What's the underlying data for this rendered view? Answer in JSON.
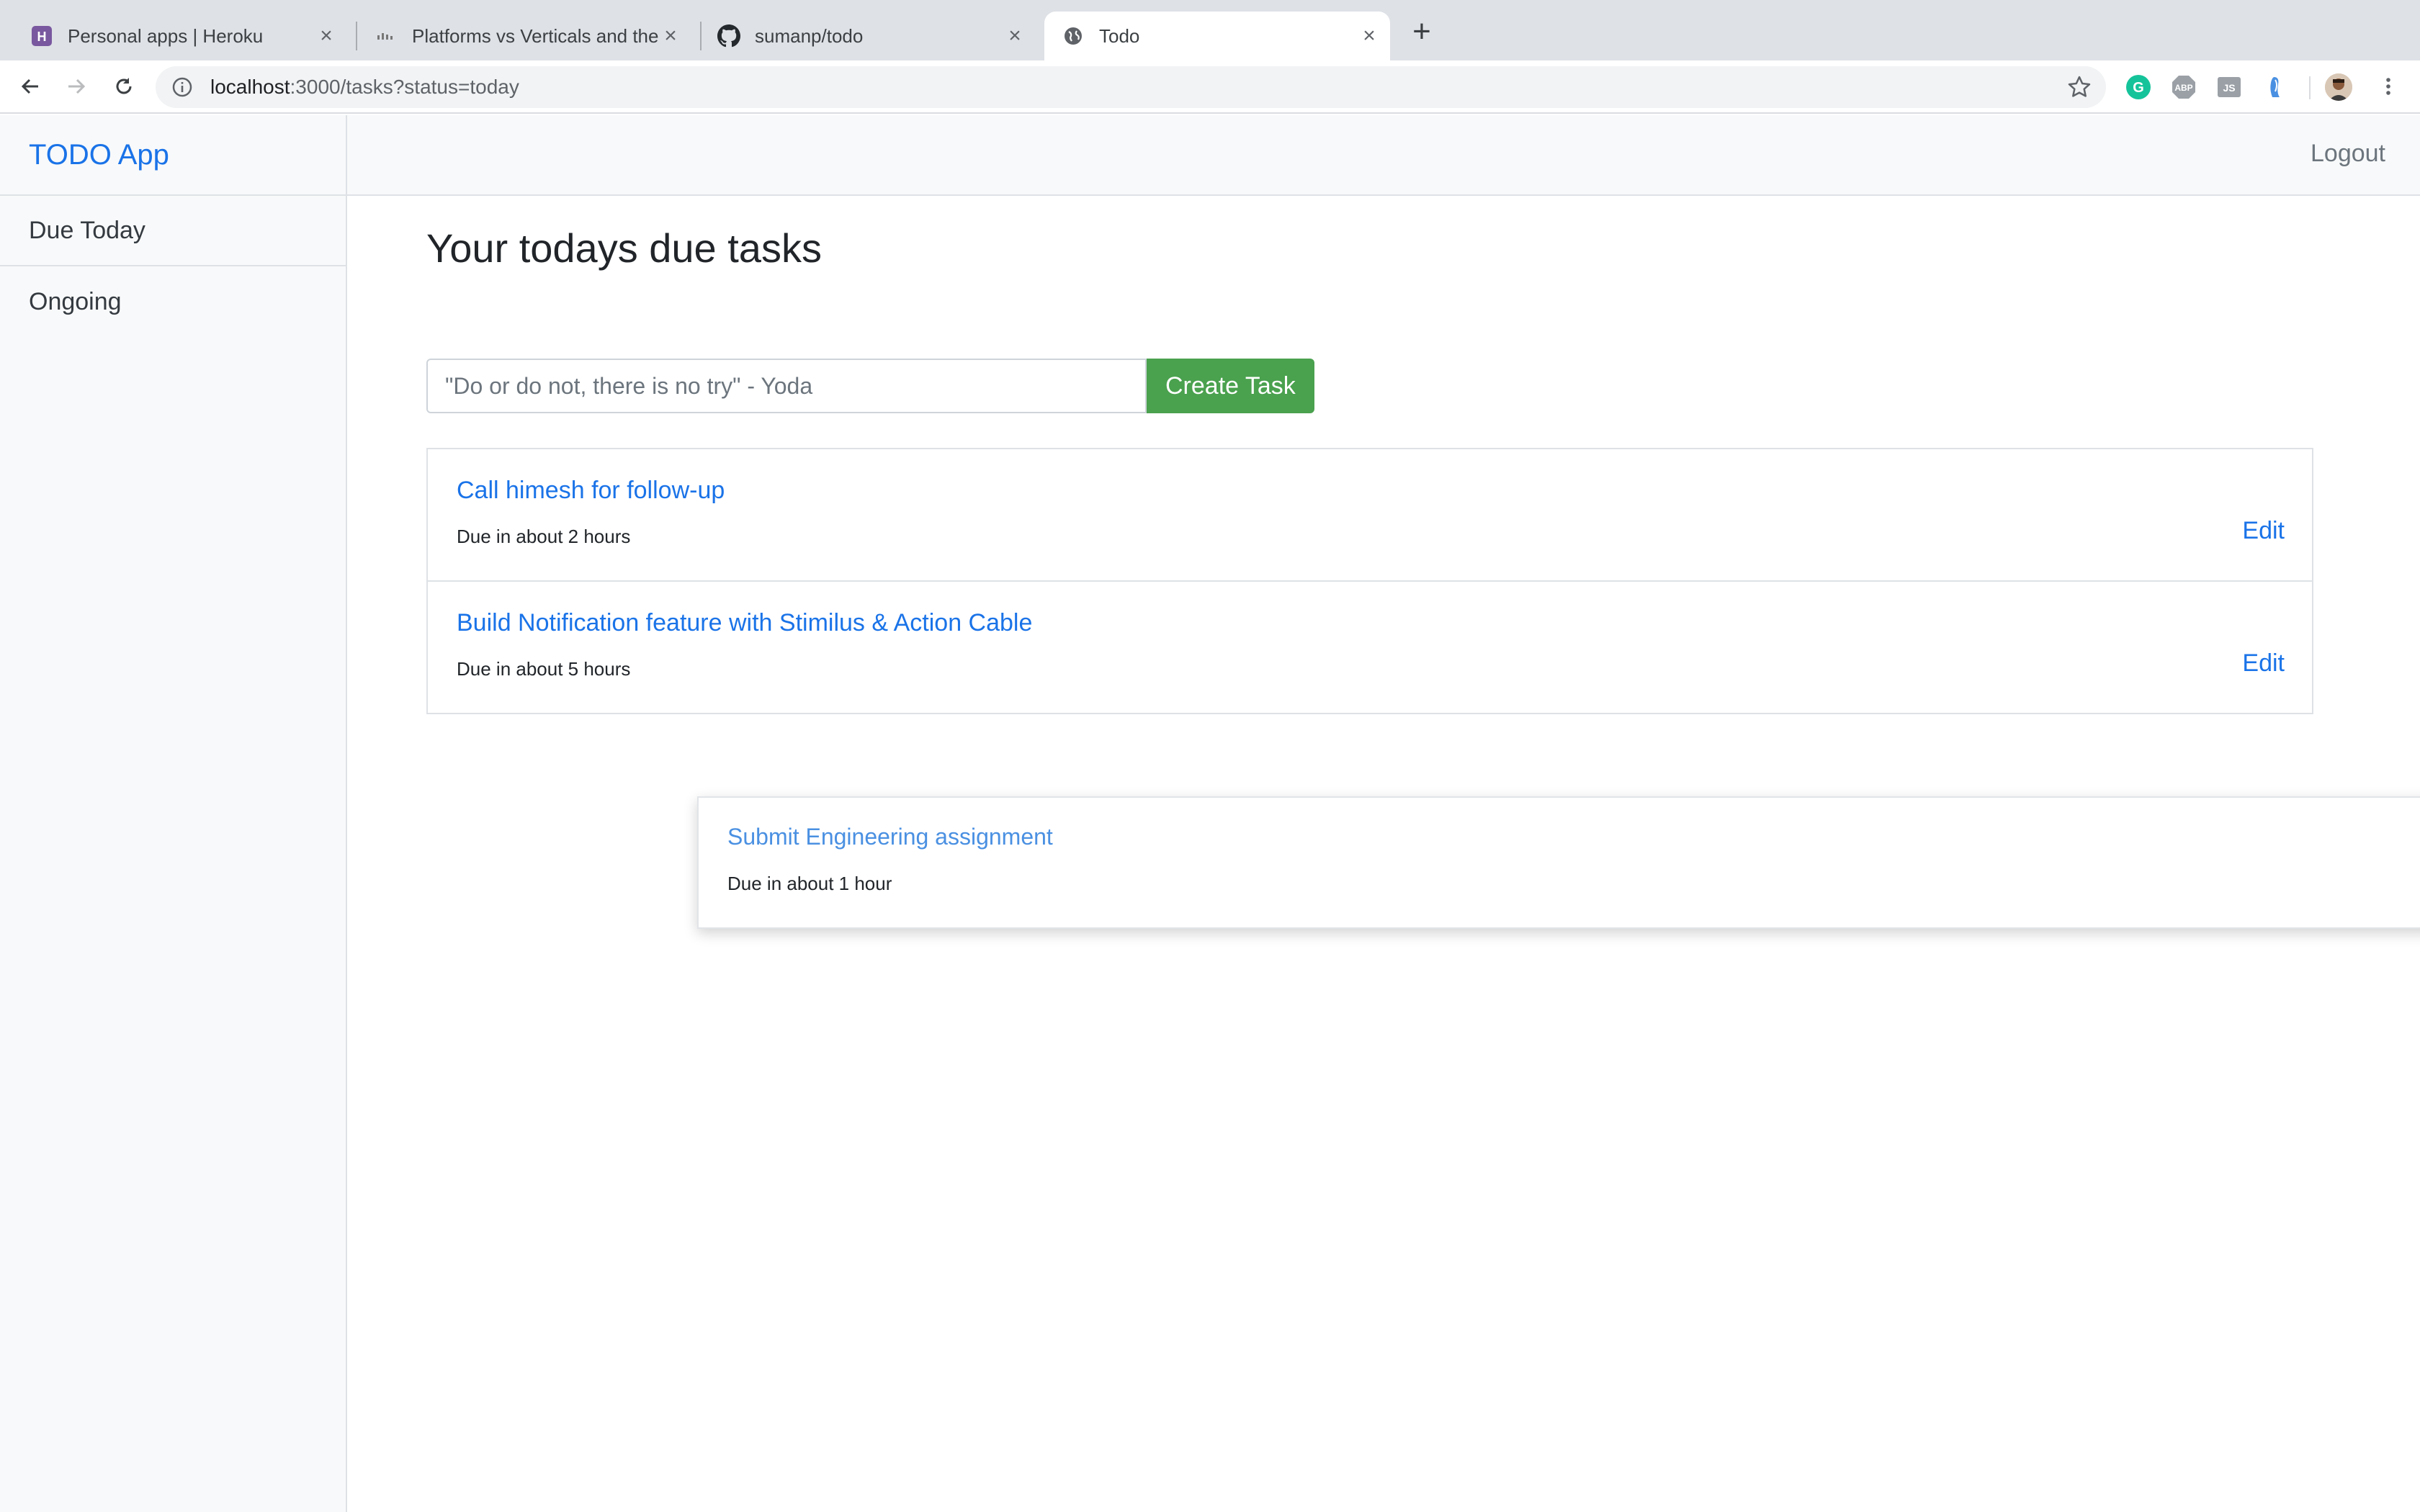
{
  "browser": {
    "tabs": [
      {
        "title": "Personal apps | Heroku",
        "icon": "heroku-icon",
        "active": false
      },
      {
        "title": "Platforms vs Verticals and the",
        "icon": "site-icon",
        "active": false
      },
      {
        "title": "sumanp/todo",
        "icon": "github-icon",
        "active": false
      },
      {
        "title": "Todo",
        "icon": "globe-icon",
        "active": true
      }
    ],
    "url_host": "localhost",
    "url_rest": ":3000/tasks?status=today",
    "extensions": [
      {
        "name": "grammarly-icon",
        "label": "G",
        "color": "#15c39a"
      },
      {
        "name": "adblock-icon",
        "label": "ABP",
        "color": "#9aa0a6"
      },
      {
        "name": "js-extension-icon",
        "label": "JS",
        "color": "#9aa0a6"
      },
      {
        "name": "extension-icon",
        "label": "",
        "color": "#4a90e2"
      }
    ]
  },
  "app": {
    "brand": "TODO App",
    "sidebar": {
      "items": [
        {
          "label": "Due Today"
        },
        {
          "label": "Ongoing"
        }
      ]
    },
    "topnav": {
      "logout": "Logout"
    },
    "page_title": "Your todays due tasks",
    "form": {
      "placeholder": "\"Do or do not, there is no try\" - Yoda",
      "submit": "Create Task"
    },
    "tasks": [
      {
        "title": "Call himesh for follow-up",
        "due": "Due in about 2 hours",
        "edit": "Edit"
      },
      {
        "title": "Build Notification feature with Stimilus & Action Cable",
        "due": "Due in about 5 hours",
        "edit": "Edit"
      }
    ],
    "dragging_task": {
      "title": "Submit Engineering assignment",
      "due": "Due in about 1 hour"
    },
    "colors": {
      "brand": "#1a73e8",
      "create_button": "#4aa14e"
    }
  }
}
